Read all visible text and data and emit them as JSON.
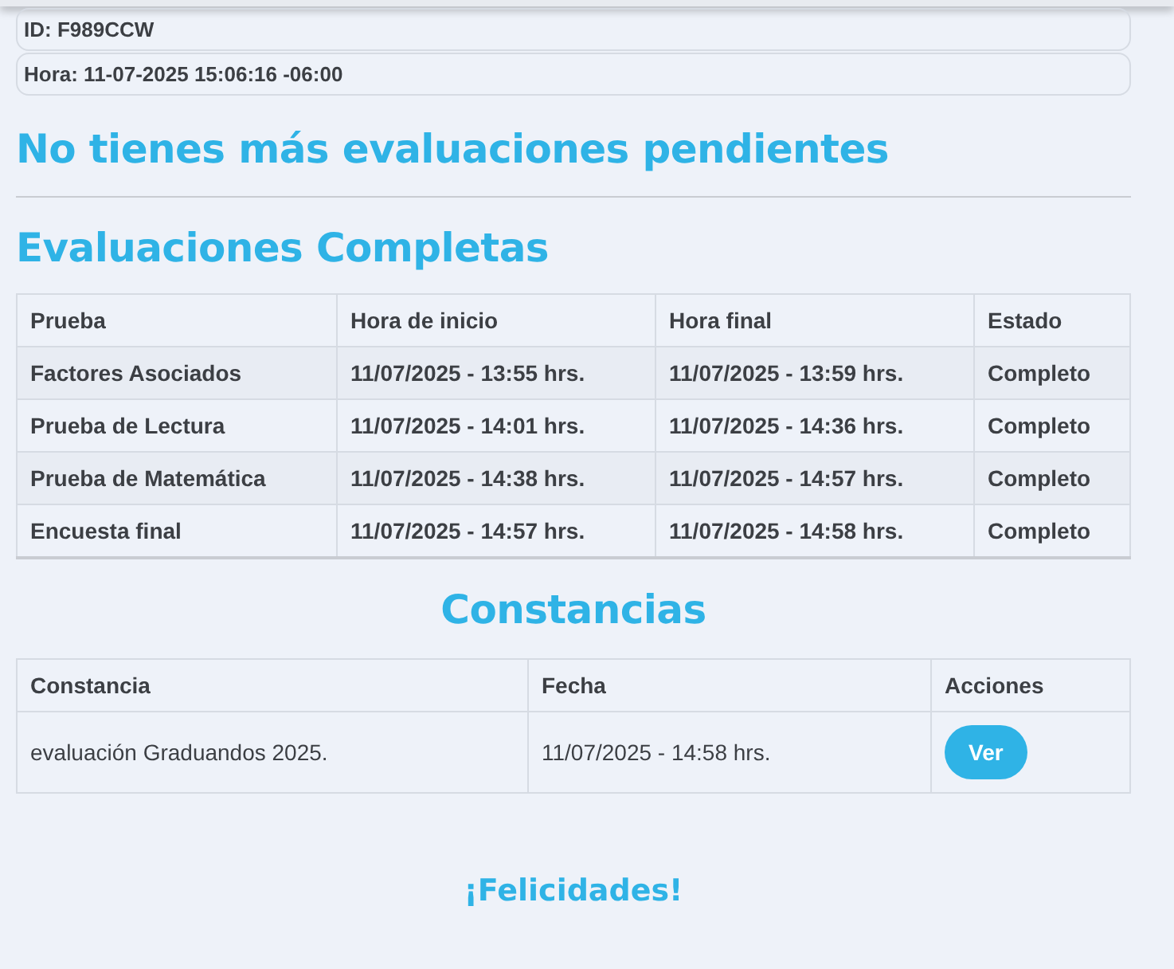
{
  "info": [
    "ID: F989CCW",
    "Hora: 11-07-2025 15:06:16 -06:00"
  ],
  "pending_heading": "No tienes más evaluaciones pendientes",
  "completed": {
    "heading": "Evaluaciones Completas",
    "columns": [
      "Prueba",
      "Hora de inicio",
      "Hora final",
      "Estado"
    ],
    "rows": [
      [
        "Factores Asociados",
        "11/07/2025 - 13:55 hrs.",
        "11/07/2025 - 13:59 hrs.",
        "Completo"
      ],
      [
        "Prueba de Lectura",
        "11/07/2025 - 14:01 hrs.",
        "11/07/2025 - 14:36 hrs.",
        "Completo"
      ],
      [
        "Prueba de Matemática",
        "11/07/2025 - 14:38 hrs.",
        "11/07/2025 - 14:57 hrs.",
        "Completo"
      ],
      [
        "Encuesta final",
        "11/07/2025 - 14:57 hrs.",
        "11/07/2025 - 14:58 hrs.",
        "Completo"
      ]
    ]
  },
  "certificates": {
    "heading": "Constancias",
    "columns": [
      "Constancia",
      "Fecha",
      "Acciones"
    ],
    "rows": [
      {
        "name": "evaluación Graduandos 2025.",
        "date": "11/07/2025 - 14:58 hrs.",
        "action": "Ver"
      }
    ]
  },
  "footer": "¡Felicidades!"
}
